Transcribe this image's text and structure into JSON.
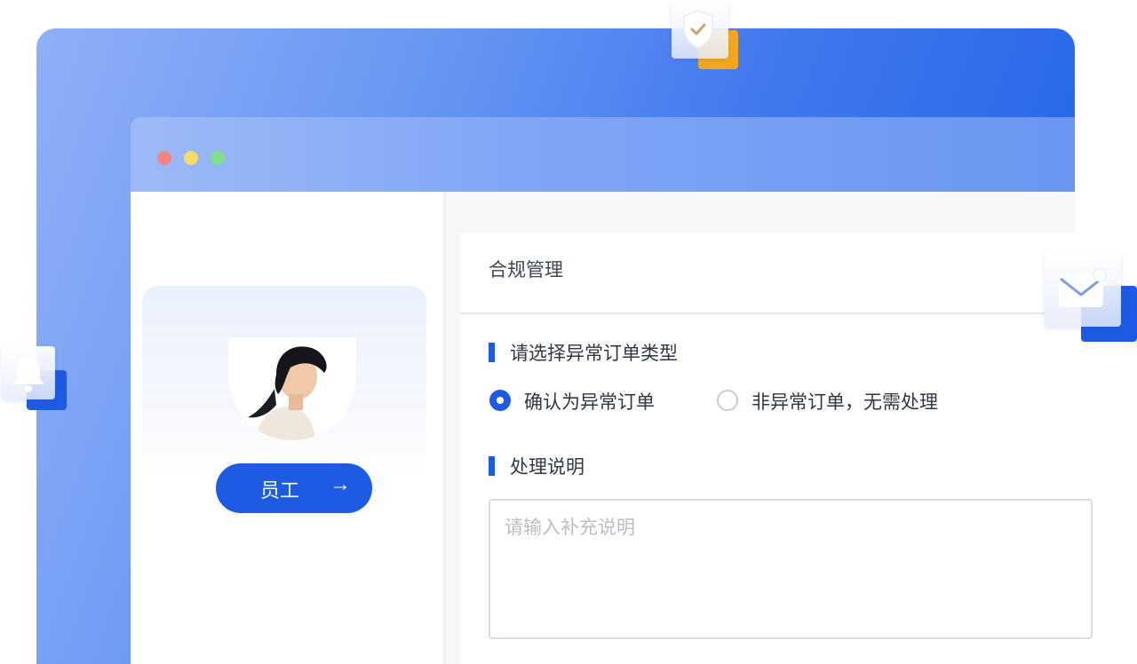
{
  "window": {
    "traffic_lights": [
      "close",
      "minimize",
      "maximize"
    ]
  },
  "profile": {
    "button_label": "员工",
    "button_icon": "arrow-right-icon"
  },
  "panel": {
    "title": "合规管理",
    "section_type": "请选择异常订单类型",
    "option_abnormal": "确认为异常订单",
    "option_normal": "非异常订单，无需处理",
    "selected_option": "确认为异常订单",
    "section_note": "处理说明",
    "note_placeholder": "请输入补充说明",
    "note_value": ""
  },
  "floating_icons": [
    "shield-check-icon",
    "mail-icon",
    "bell-icon"
  ],
  "colors": {
    "accent": "#1d5be2",
    "shield_accent": "#f4a71d",
    "frame_start": "#8fb0f6",
    "frame_end": "#1b5fe8"
  }
}
